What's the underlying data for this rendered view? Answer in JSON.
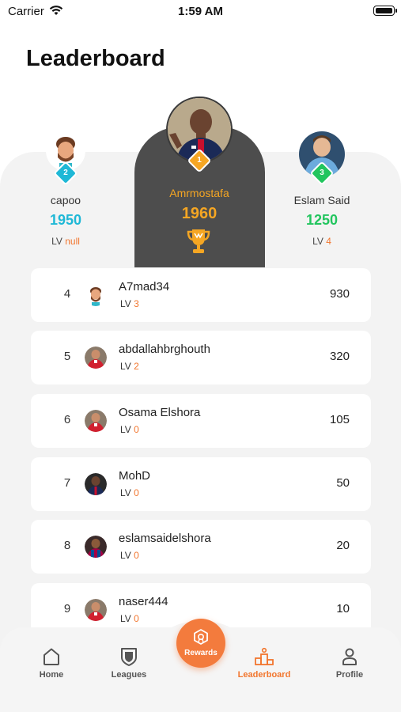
{
  "status_bar": {
    "carrier": "Carrier",
    "time": "1:59 AM"
  },
  "header": {
    "title": "Leaderboard"
  },
  "podium": {
    "first": {
      "rank": "1",
      "name": "Amrmostafa",
      "score": "1960",
      "name_color": "#f5a623",
      "score_color": "#f5a623",
      "badge_color": "#f5a623"
    },
    "second": {
      "rank": "2",
      "name": "capoo",
      "score": "1950",
      "lv_label": "LV",
      "lv_value": "null",
      "score_color": "#1fb8d6",
      "badge_color": "#1fb8d6"
    },
    "third": {
      "rank": "3",
      "name": "Eslam Said",
      "score": "1250",
      "lv_label": "LV",
      "lv_value": "4",
      "score_color": "#22c55e",
      "badge_color": "#22c55e"
    }
  },
  "list": [
    {
      "rank": "4",
      "name": "A7mad34",
      "lv_label": "LV",
      "lv_value": "3",
      "score": "930"
    },
    {
      "rank": "5",
      "name": "abdallahbrghouth",
      "lv_label": "LV",
      "lv_value": "2",
      "score": "320"
    },
    {
      "rank": "6",
      "name": "Osama Elshora",
      "lv_label": "LV",
      "lv_value": "0",
      "score": "105"
    },
    {
      "rank": "7",
      "name": "MohD",
      "lv_label": "LV",
      "lv_value": "0",
      "score": "50"
    },
    {
      "rank": "8",
      "name": "eslamsaidelshora",
      "lv_label": "LV",
      "lv_value": "0",
      "score": "20"
    },
    {
      "rank": "9",
      "name": "naser444",
      "lv_label": "LV",
      "lv_value": "0",
      "score": "10"
    }
  ],
  "tabbar": {
    "home": "Home",
    "leagues": "Leagues",
    "rewards": "Rewards",
    "leaderboard": "Leaderboard",
    "profile": "Profile"
  },
  "colors": {
    "accent": "#f2762e",
    "podium_dark": "#4d4d4d",
    "background_gray": "#f3f3f3"
  },
  "icons": [
    "wifi-icon",
    "battery-icon",
    "trophy-icon",
    "home-icon",
    "shield-icon",
    "rewards-icon",
    "podium-icon",
    "profile-icon"
  ]
}
